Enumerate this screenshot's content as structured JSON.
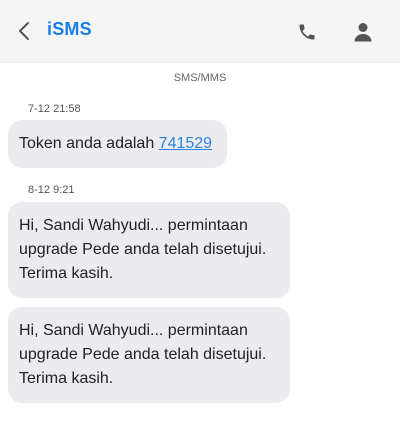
{
  "header": {
    "title": "iSMS",
    "back_icon": "chevron-left-icon",
    "call_icon": "phone-icon",
    "contact_icon": "person-icon"
  },
  "thread": {
    "channel_label": "SMS/MMS",
    "messages": [
      {
        "timestamp": "7-12 21:58",
        "text_prefix": "Token anda adalah ",
        "token": "741529"
      },
      {
        "timestamp": "8-12 9:21",
        "lines": [
          "Hi, Sandi Wahyudi... permintaan",
          "upgrade Pede anda telah disetujui.",
          "Terima kasih."
        ]
      },
      {
        "lines": [
          "Hi, Sandi Wahyudi... permintaan",
          "upgrade Pede anda telah disetujui.",
          "Terima kasih."
        ]
      }
    ]
  },
  "colors": {
    "accent": "#1a7ce5",
    "bubble": "#ecebf0",
    "header_bg": "#f5f5f5"
  }
}
